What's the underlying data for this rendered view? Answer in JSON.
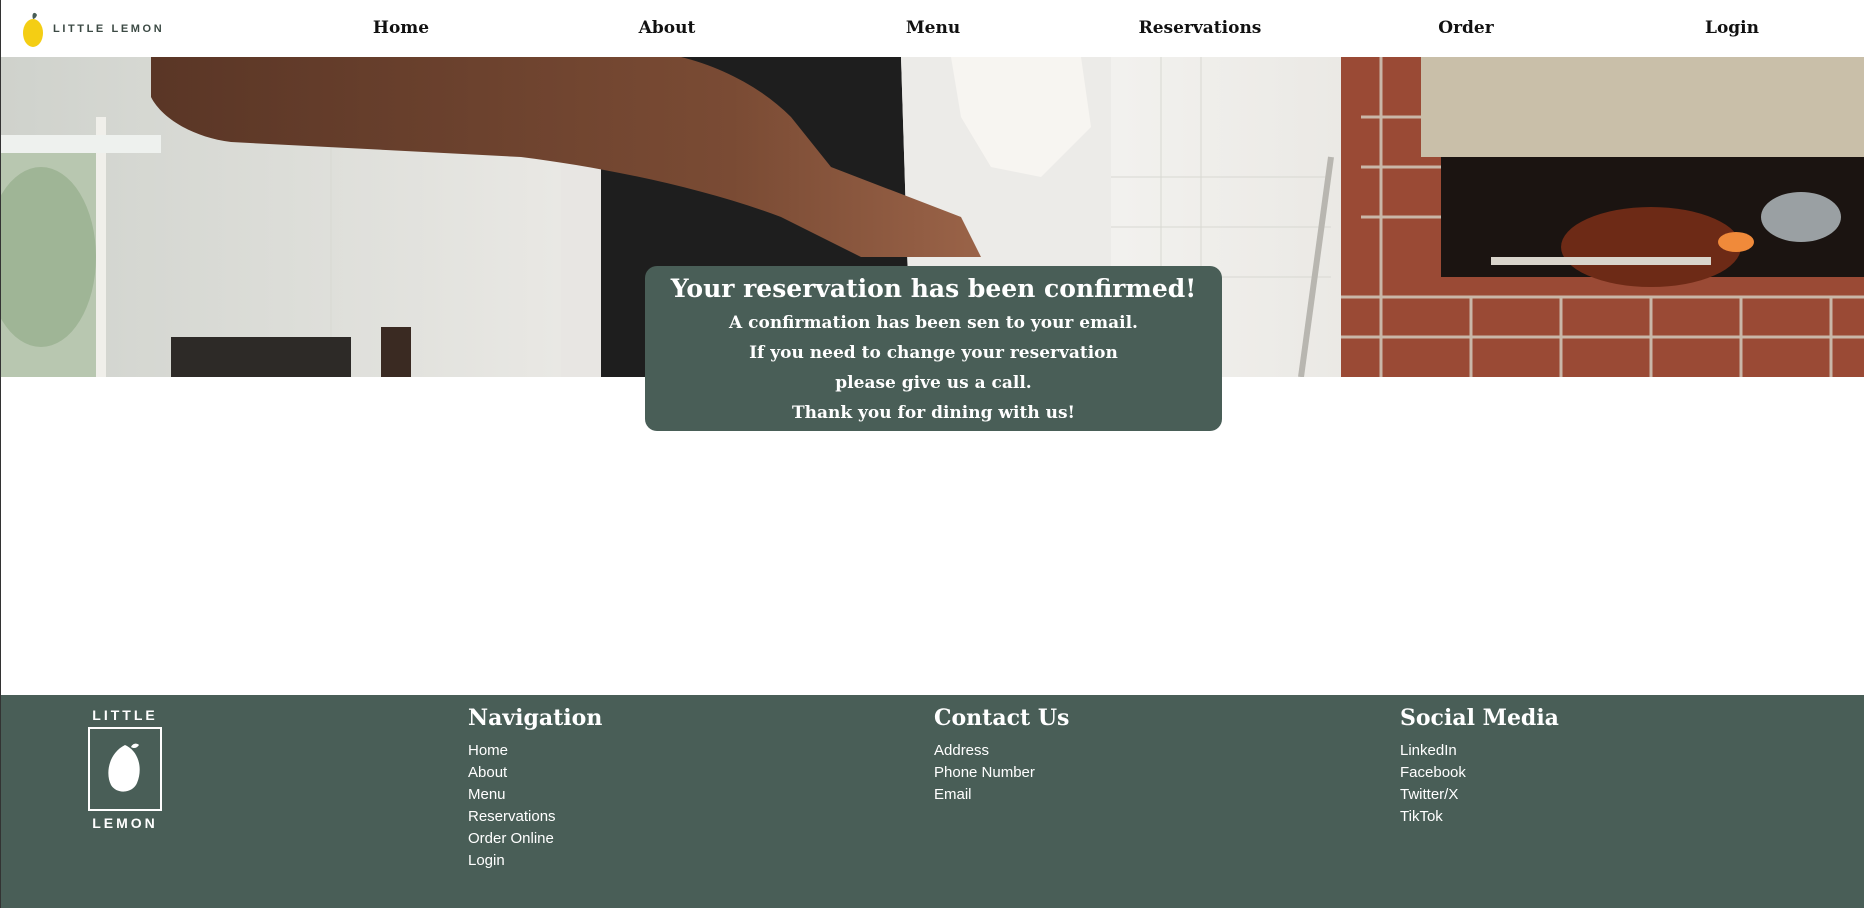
{
  "header": {
    "logo_text": "LITTLE LEMON",
    "nav": [
      {
        "label": "Home"
      },
      {
        "label": "About"
      },
      {
        "label": "Menu"
      },
      {
        "label": "Reservations"
      },
      {
        "label": "Order"
      },
      {
        "label": "Login"
      }
    ]
  },
  "confirmation": {
    "title": "Your reservation has been confirmed!",
    "lines": [
      "A confirmation has been sen to your email.",
      "If you need to change your reservation",
      "please give us a call.",
      "Thank you for dining with us!"
    ]
  },
  "footer": {
    "logo_top": "LITTLE",
    "logo_bottom": "LEMON",
    "navigation": {
      "title": "Navigation",
      "items": [
        "Home",
        "About",
        "Menu",
        "Reservations",
        "Order Online",
        "Login"
      ]
    },
    "contact": {
      "title": "Contact Us",
      "items": [
        "Address",
        "Phone Number",
        "Email"
      ]
    },
    "social": {
      "title": "Social Media",
      "items": [
        "LinkedIn",
        "Facebook",
        "Twitter/X",
        "TikTok"
      ]
    }
  },
  "colors": {
    "brand_green": "#495e57",
    "brand_yellow": "#f4ce14",
    "header_bg": "#ffffff"
  },
  "icons": {
    "header_logo": "lemon-icon",
    "footer_logo": "lemon-outline-icon"
  }
}
